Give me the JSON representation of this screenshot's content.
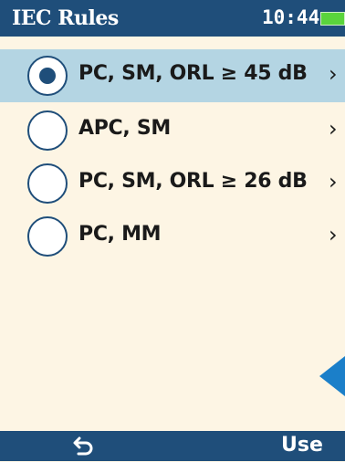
{
  "header": {
    "title": "IEC Rules",
    "time": "10:44",
    "battery_color": "#5ad43c"
  },
  "rules": [
    {
      "label": "PC, SM, ORL ≥ 45 dB",
      "selected": true
    },
    {
      "label": "APC, SM",
      "selected": false
    },
    {
      "label": "PC, SM, ORL ≥ 26 dB",
      "selected": false
    },
    {
      "label": "PC, MM",
      "selected": false
    }
  ],
  "chevron": "›",
  "footer": {
    "back_icon": "back-arrow-icon",
    "use_label": "Use"
  },
  "colors": {
    "bar": "#1f4e7a",
    "selected_row": "#b4d5e3",
    "background": "#fdf5e4",
    "accent": "#1b7fc9"
  }
}
